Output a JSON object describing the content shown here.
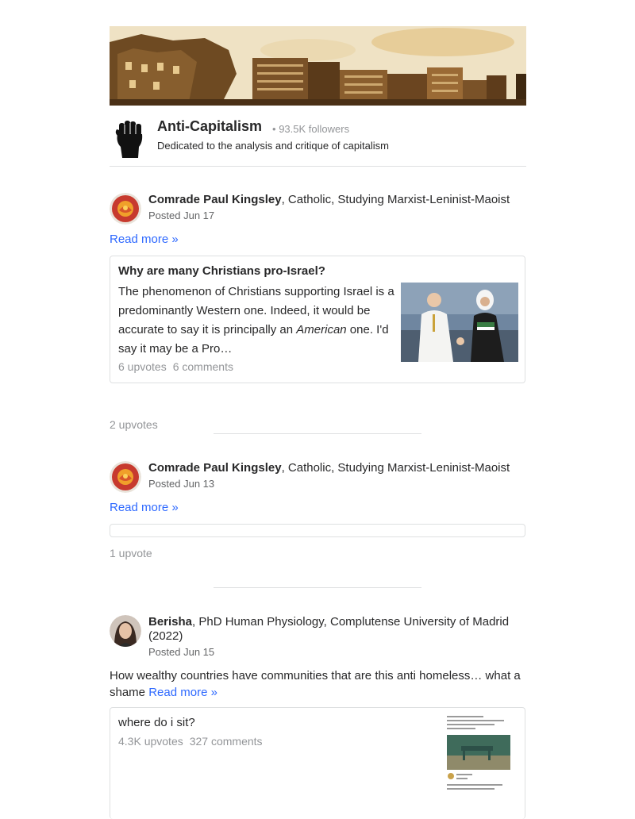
{
  "space": {
    "name": "Anti-Capitalism",
    "separator": "•",
    "followers": "93.5K followers",
    "description": "Dedicated to the analysis and critique of capitalism"
  },
  "posts": [
    {
      "author_name": "Comrade Paul Kingsley",
      "author_credential": ", Catholic, Studying Marxist-Leninist-Maoist",
      "posted": "Posted Jun 17",
      "read_more": "Read more »",
      "card": {
        "title": "Why are many Christians pro-Israel?",
        "body_before": "The phenomenon of Christians supporting Israel is a predominantly Western one. Indeed, it would be accurate to say it is principally an ",
        "body_italic": "American",
        "body_after": " one. I'd say it may be a Pro…",
        "upvotes": "6 upvotes",
        "comments": "6 comments"
      },
      "upvotes": "2 upvotes"
    },
    {
      "author_name": "Comrade Paul Kingsley",
      "author_credential": ", Catholic, Studying Marxist-Leninist-Maoist",
      "posted": "Posted Jun 13",
      "read_more": "Read more »",
      "upvotes": "1 upvote"
    },
    {
      "author_name": "Berisha",
      "author_credential": ", PhD Human Physiology, Complutense University of Madrid (2022)",
      "posted": "Posted Jun 15",
      "snippet": "How wealthy countries have communities that are this anti homeless… what a shame ",
      "read_more": "Read more »",
      "card": {
        "title": "where do i sit?",
        "upvotes": "4.3K upvotes",
        "comments": "327 comments"
      }
    }
  ],
  "colors": {
    "link": "#2e69ff",
    "muted": "#939598",
    "border": "#dee0e1",
    "avatar_red": "#c73a2e"
  }
}
